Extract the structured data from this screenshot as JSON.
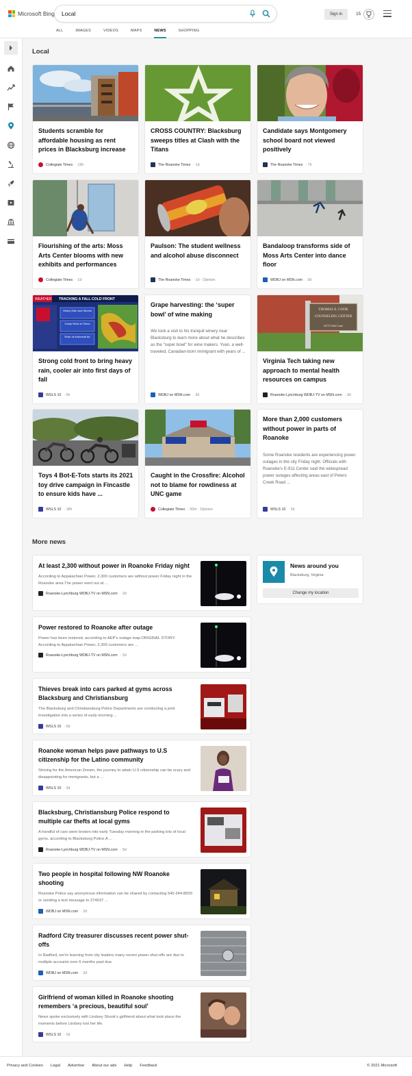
{
  "brand": {
    "name": "Microsoft Bing"
  },
  "search": {
    "query": "Local"
  },
  "header": {
    "signin_label": "Sign in",
    "rewards_count": "15"
  },
  "scopes": [
    "ALL",
    "IMAGES",
    "VIDEOS",
    "MAPS",
    "NEWS",
    "SHOPPING"
  ],
  "active_scope": "NEWS",
  "sections": {
    "local_title": "Local",
    "more_title": "More news"
  },
  "cards": [
    {
      "title": "Students scramble for affordable housing as rent prices in Blacksburg increase",
      "source": "Collegiate Times",
      "meta": "· 19h"
    },
    {
      "title": "CROSS COUNTRY: Blacksburg sweeps titles at Clash with the Titans",
      "source": "The Roanoke Times",
      "meta": "· 1d"
    },
    {
      "title": "Candidate says Montgomery school board not viewed positively",
      "source": "The Roanoke Times",
      "meta": "· 7h"
    },
    {
      "title": "Flourishing of the arts: Moss Arts Center blooms with new exhibits and performances",
      "source": "Collegiate Times",
      "meta": "· 1d"
    },
    {
      "title": "Paulson: The student wellness and alcohol abuse disconnect",
      "source": "The Roanoke Times",
      "meta": "· 1d · Opinion"
    },
    {
      "title": "Bandaloop transforms side of Moss Arts Center into dance floor",
      "source": "WDBJ on MSN.com",
      "meta": "· 3d"
    },
    {
      "title": "Strong cold front to bring heavy rain, cooler air into first days of fall",
      "source": "WSLS 10",
      "meta": "· 5h",
      "img_text": {
        "banner": "TRACKING A FALL COLD FRONT",
        "brand": "WEATHER",
        "line1": "Heavy Rain and Storms",
        "line2": "Gusty Wind at Times",
        "line3": "Rush of Autumnal Air"
      }
    },
    {
      "title": "Grape harvesting: the ‘super bowl’ of wine making",
      "snippet": "We took a visit to his tranquil winery near Blacksburg to learn more about what he describes as the “super bowl” for wine makers. Yvan, a well-traveled, Canadian-born immigrant with years of ...",
      "source": "WDBJ on MSN.com",
      "meta": "· 3d"
    },
    {
      "title": "Virginia Tech taking new approach to mental health resources on campus",
      "source": "Roanoke-Lynchburg WDBJ-TV on MSN.com",
      "meta": "· 3d",
      "img_text": {
        "sign1": "THOMAS E. COOK",
        "sign2": "COUNSELING CENTER",
        "sign3": "2475 Oak Lane"
      }
    },
    {
      "title": "Toys 4 Bot-E-Tots starts its 2021 toy drive campaign in Fincastle to ensure kids have ...",
      "source": "WSLS 10",
      "meta": "· 18h"
    },
    {
      "title": "Caught in the Crossfire: Alcohol not to blame for rowdiness at UNC game",
      "source": "Collegiate Times",
      "meta": "· 50m · Opinion"
    },
    {
      "title": "More than 2,000 customers without power in parts of Roanoke",
      "snippet": "Some Roanoke residents are experiencing power outages in the city Friday night. Officials with Roanoke’s E-911 Center said the widespread power outages affecting areas east of Peters Creek Road ...",
      "source": "WSLS 10",
      "meta": "· 2d"
    }
  ],
  "more_news": [
    {
      "title": "At least 2,300 without power in Roanoke Friday night",
      "snippet": "According to Appalachian Power, 2,300 customers are without power Friday night in the Roanoke area.The power went out at ...",
      "source": "Roanoke-Lynchburg WDBJ-TV on MSN.com",
      "meta": "· 2d"
    },
    {
      "title": "Power restored to Roanoke after outage",
      "snippet": "Power has been restored, according to AEP’s outage map.ORIGINAL STORY: According to Appalachian Power, 2,300 customers are ...",
      "source": "Roanoke-Lynchburg WDBJ-TV on MSN.com",
      "meta": "· 2d"
    },
    {
      "title": "Thieves break into cars parked at gyms across Blacksburg and Christiansburg",
      "snippet": "The Blacksburg and Christiansburg Police Departments are conducting a joint investigation into a series of early-morning ...",
      "source": "WSLS 10",
      "meta": "· 5d"
    },
    {
      "title": "Roanoke woman helps pave pathways to U.S citizenship for the Latino community",
      "snippet": "Striving for the American Dream, the journey to attain U.S citizenship can be scary and disappointing for immigrants, but a ...",
      "source": "WSLS 10",
      "meta": "· 3d"
    },
    {
      "title": "Blacksburg, Christiansburg Police respond to multiple car thefts at local gyms",
      "snippet": "A handful of cars were broken into early Tuesday morning in the parking lots of local gyms, according to Blacksburg Police.A ...",
      "source": "Roanoke-Lynchburg WDBJ-TV on MSN.com",
      "meta": "· 5d"
    },
    {
      "title": "Two people in hospital following NW Roanoke shooting",
      "snippet": "Roanoke Police say anonymous information can be shared by contacting 540-344-8500 or sending a text message to 274637 ...",
      "source": "WDBJ on MSN.com",
      "meta": "· 2d"
    },
    {
      "title": "Radford City treasurer discusses recent power shut-offs",
      "snippet": "In Radford, we’re learning from city leaders many recent power shut-offs are due to multiple accounts over 6 months past due.",
      "source": "WDBJ on MSN.com",
      "meta": "· 2d"
    },
    {
      "title": "Girlfriend of woman killed in Roanoke shooting remembers ‘a precious, beautiful soul’",
      "snippet": "News spoke exclusively with Lindsey Shook’s girlfriend about what took place the moments before Lindsey lost her life.",
      "source": "WSLS 10",
      "meta": "· 2d"
    }
  ],
  "around": {
    "title": "News around you",
    "location": "Blacksburg, Virginia",
    "button": "Change my location"
  },
  "footer": {
    "links": [
      "Privacy and Cookies",
      "Legal",
      "Advertise",
      "About our ads",
      "Help",
      "Feedback"
    ],
    "copyright": "© 2021 Microsoft"
  },
  "colors": {
    "accent": "#2b8da6",
    "ms_red": "#f25022",
    "ms_green": "#7fba00",
    "ms_blue": "#00a4ef",
    "ms_yellow": "#ffb900"
  },
  "icons": {
    "rail": [
      "home-icon",
      "trending-icon",
      "flag-icon",
      "location-pin-icon",
      "globe-icon",
      "microscope-icon",
      "rocket-icon",
      "video-icon",
      "bank-icon",
      "card-icon"
    ]
  }
}
